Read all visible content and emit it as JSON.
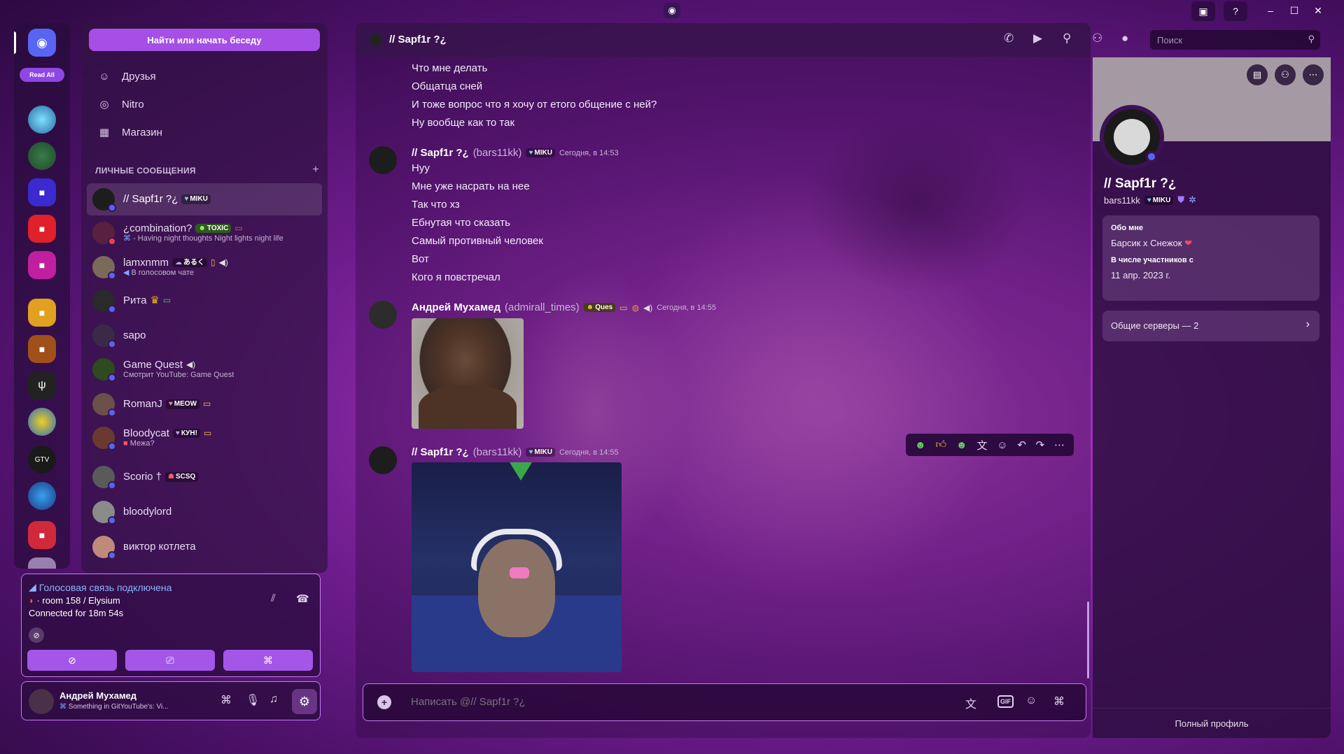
{
  "titlebar": {
    "logo": "discord-icon",
    "inbox": "inbox-icon",
    "help": "?",
    "minimize": "–",
    "maximize": "☐",
    "close": "✕"
  },
  "rail": {
    "read_all": "Read All"
  },
  "sidebar": {
    "find_button": "Найти или начать беседу",
    "nav": [
      {
        "label": "Друзья",
        "icon": "friends-icon"
      },
      {
        "label": "Nitro",
        "icon": "nitro-icon"
      },
      {
        "label": "Магазин",
        "icon": "shop-icon"
      }
    ],
    "dm_header": "ЛИЧНЫЕ СООБЩЕНИЯ",
    "dm_add": "+",
    "dms": [
      {
        "name": "// Sapf1r ?¿",
        "tag": "MIKU",
        "sub": "",
        "status_color": "#5865f2",
        "avatar_color": "#1d1d1d"
      },
      {
        "name": "¿combination?",
        "tag": "TOXIC",
        "sub": "- Having night thoughts Night lights night life",
        "status_color": "#f23f43",
        "avatar_color": "#5a2040"
      },
      {
        "name": "lamxnmm",
        "tag": "あるく",
        "sub": "В голосовом чате",
        "status_color": "#5865f2",
        "avatar_color": "#7a6a5a"
      },
      {
        "name": "Рита",
        "tag": "",
        "sub": "",
        "status_color": "#5865f2",
        "avatar_color": "#2a2a2a"
      },
      {
        "name": "sapo",
        "tag": "",
        "sub": "",
        "status_color": "#5865f2",
        "avatar_color": "#3a2a48"
      },
      {
        "name": "Game Quest",
        "tag": "",
        "sub": "Смотрит YouTube: Game Quest",
        "status_color": "#5865f2",
        "avatar_color": "#2e4a20"
      },
      {
        "name": "RomanJ",
        "tag": "MEOW",
        "sub": "",
        "status_color": "#5865f2",
        "avatar_color": "#6a5048"
      },
      {
        "name": "Bloodycat",
        "tag": "КУН!",
        "sub": "Межа?",
        "status_color": "#5865f2",
        "avatar_color": "#6a3a30"
      },
      {
        "name": "Scorio †",
        "tag": "SCSQ",
        "sub": "",
        "status_color": "#5865f2",
        "avatar_color": "#5a5a5a"
      },
      {
        "name": "bloodylord",
        "tag": "",
        "sub": "",
        "status_color": "#5865f2",
        "avatar_color": "#8a8a8a"
      },
      {
        "name": "виктор котлета",
        "tag": "",
        "sub": "",
        "status_color": "#5865f2",
        "avatar_color": "#c08a7a"
      }
    ]
  },
  "voice": {
    "title": "Голосовая связь подключена",
    "room": "· room 158 / Elysium",
    "connected": "Connected for 18m  54s"
  },
  "user": {
    "name": "Андрей Мухамед",
    "status": "Something in GitYouTube's: Vi..."
  },
  "chat": {
    "header_name": "// Sapf1r ?¿",
    "search_placeholder": "Поиск",
    "groups": [
      {
        "lines": [
          "Что мне делать",
          "Общатца сней",
          "И тоже вопрос что я хочу от етого общение с ней?",
          "Ну вообще как то так"
        ]
      },
      {
        "author": "// Sapf1r ?¿",
        "username": "(bars11kk)",
        "tag": "MIKU",
        "time": "Сегодня, в 14:53",
        "lines": [
          "Нуу",
          "Мне уже насрать на нее",
          "Так что хз",
          "Ебнутая что сказать",
          "Самый противный человек",
          "Вот",
          "Кого я повстречал"
        ]
      },
      {
        "author": "Андрей Мухамед",
        "username": "(admirall_times)",
        "tag": "Ques",
        "time": "Сегодня, в 14:55"
      },
      {
        "author": "// Sapf1r ?¿",
        "username": "(bars11kk)",
        "tag": "MIKU",
        "time": "Сегодня, в 14:55"
      }
    ],
    "composer_placeholder": "Написать @// Sapf1r ?¿",
    "gif": "GIF"
  },
  "profile": {
    "display_name": "// Sapf1r ?¿",
    "username": "bars11kk",
    "tag": "MIKU",
    "about_label": "Обо мне",
    "about_text": "Барсик х Снежок",
    "member_since_label": "В числе участников с",
    "member_since": "11 апр. 2023 г.",
    "mutual_servers": "Общие серверы — 2",
    "full_profile": "Полный профиль"
  }
}
